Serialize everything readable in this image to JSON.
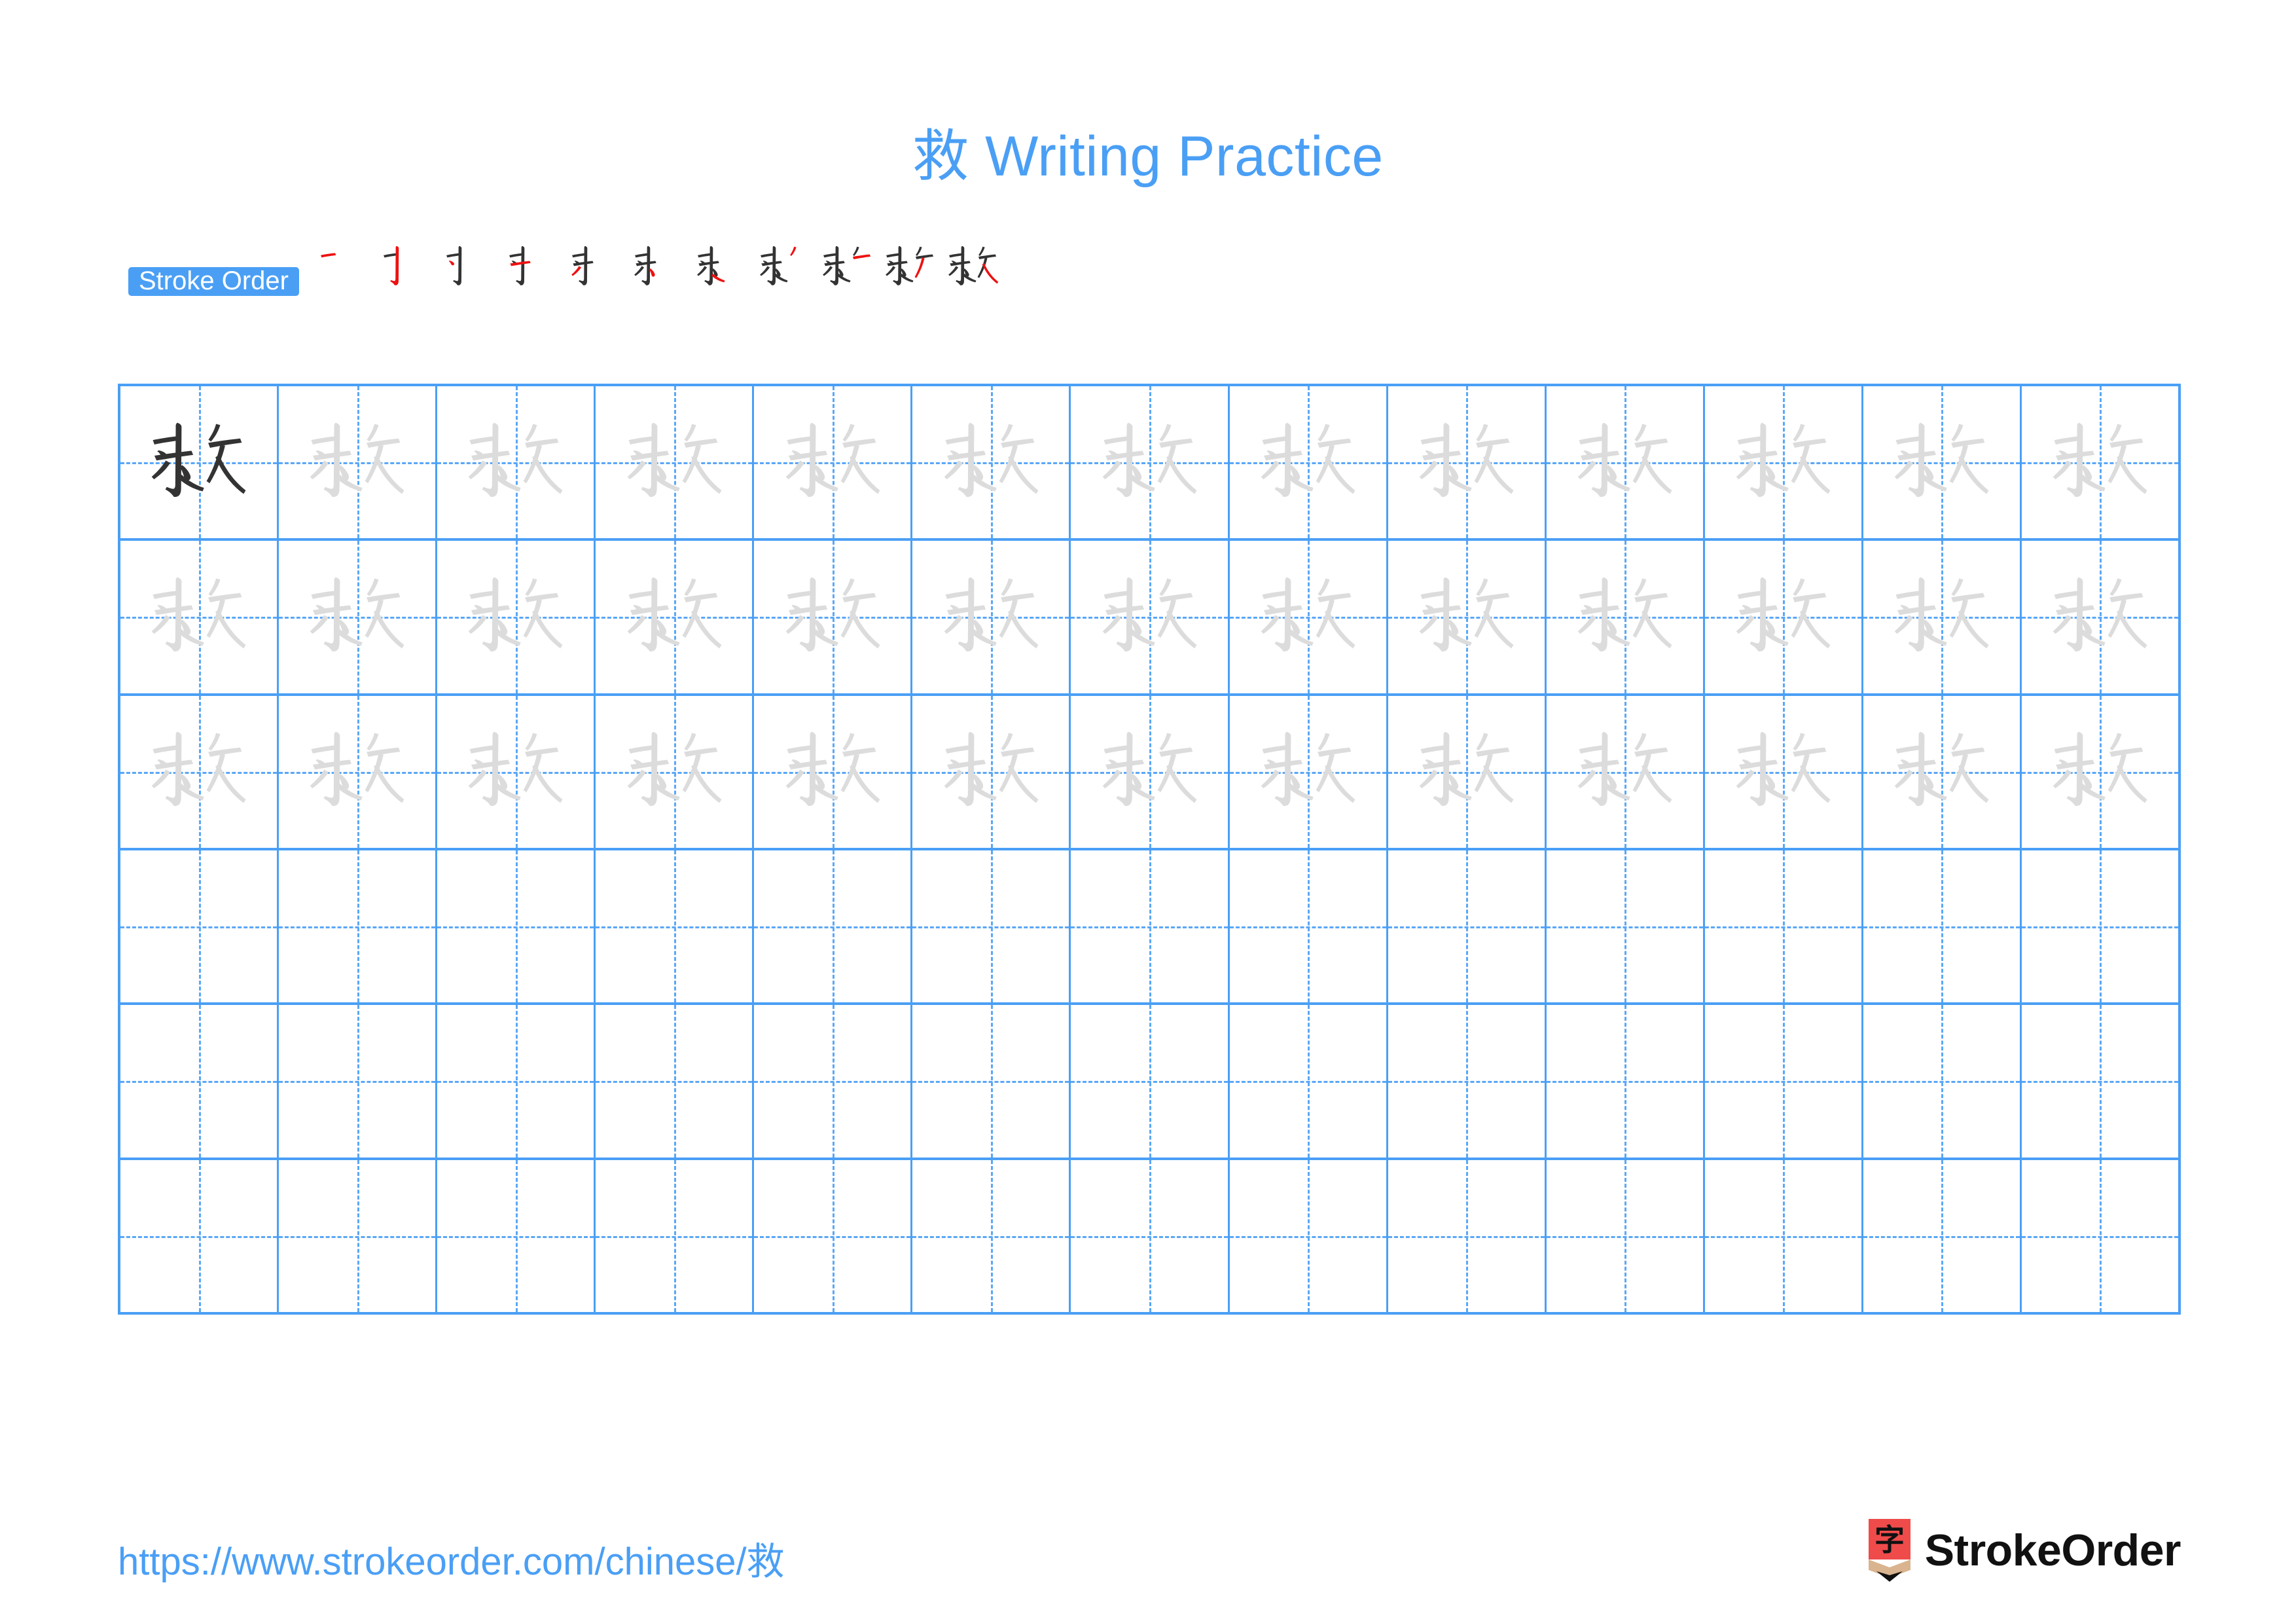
{
  "character": "救",
  "title": "救 Writing Practice",
  "colors": {
    "accent_blue": "#4a9ff5",
    "grid_line": "#4a9ff5",
    "guide_dash": "#5aa7f7",
    "trace_gray": "#dcdcdc",
    "ink_black": "#333333",
    "new_stroke_red": "#ee1111",
    "logo_red": "#ef4b4b",
    "logo_wood": "#d9b48f",
    "brand_text": "#111111"
  },
  "stroke_order": {
    "badge_label": "Stroke Order",
    "total_strokes": 11,
    "steps": [
      1,
      2,
      3,
      4,
      5,
      6,
      7,
      8,
      9,
      10,
      11
    ]
  },
  "grid": {
    "columns": 13,
    "rows": 6,
    "traced_rows": 3,
    "blank_rows": 3,
    "first_cell_is_dark": true
  },
  "footer": {
    "url": "https://www.strokeorder.com/chinese/救",
    "brand_name": "StrokeOrder",
    "brand_mark_char": "字"
  }
}
